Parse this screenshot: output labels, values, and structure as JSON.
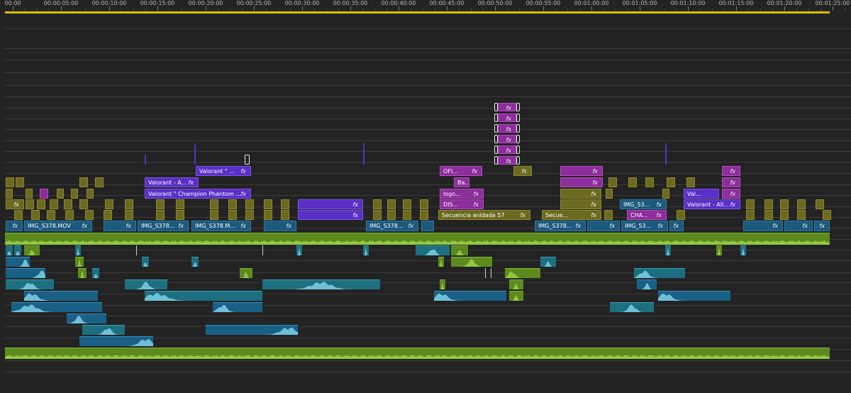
{
  "ruler": {
    "timecodes": [
      "00:00",
      "00:00:05:00",
      "00:00:10:00",
      "00:00:15:00",
      "00:00:20:00",
      "00:00:25:00",
      "00:00:30:00",
      "00:00:35:00",
      "00:00:40:00",
      "00:00:45:00",
      "00:00:50:00",
      "00:00:55:00",
      "00:01:00:00",
      "00:01:05:00",
      "00:01:10:00",
      "00:01:15:00",
      "00:01:20:00",
      "00:01:25:00"
    ]
  },
  "fx_label": "fx",
  "clips": {
    "valorant_a": "Valorant - A...",
    "valorant_champion": "Valorant \" Champion Phantom ...",
    "valorant_short": "Valorant \" ...",
    "ofi": "OFI...",
    "ba": "Ba...",
    "logo": "logo...",
    "dis": "DIS...",
    "secuencia": "Secuencia anidada 57",
    "secue": "Secue...",
    "img_s378_mov": "IMG_S378.MOV",
    "img_s378_a": "IMG_S378...",
    "img_s378_m": "IMG_S378.M...",
    "img_s378_b": "IMG_S378...",
    "img_s378_c": "IMG_S378...",
    "img_53_a": "IMG_53...",
    "img_53_b": "IMG_53...",
    "cha": "CHA...",
    "val": "Val...",
    "valorant_all": "Valorant - All..."
  },
  "colors": {
    "playhead_bar": "#d8c200",
    "olive": "#6c6a1f",
    "purple": "#5a2fc8",
    "magenta": "#8e2d9c",
    "blue": "#1c5a7d",
    "audio_green": "#5d8a1d",
    "audio_teal": "#1d6f80"
  }
}
